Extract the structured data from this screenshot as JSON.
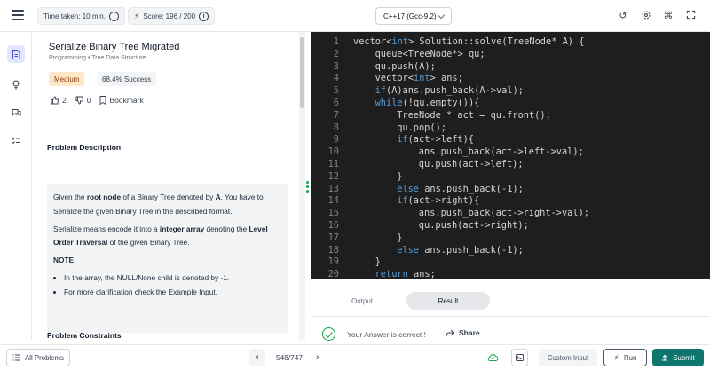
{
  "topbar": {
    "time_taken": "Time taken: 10 min.",
    "score": "Score:  196  /  200",
    "language": "C++17 (Gcc-9.2)"
  },
  "problem": {
    "title": "Serialize Binary Tree Migrated",
    "breadcrumb": "Programming • Tree Data Structure",
    "difficulty": "Medium",
    "success_rate": "68.4% Success",
    "likes": "2",
    "dislikes": "0",
    "bookmark_label": "Bookmark",
    "description_heading": "Problem Description",
    "desc": {
      "p1_a": "Given the ",
      "p1_b": "root node",
      "p1_c": "  of a Binary Tree denoted by ",
      "p1_d": "A",
      "p1_e": ". You have to Serialize the given Binary Tree in the described format.",
      "p2_a": "Serialize means encode it into a ",
      "p2_b": "integer array",
      "p2_c": " denoting the ",
      "p2_d": "Level Order Traversal",
      "p2_e": " of the given Binary Tree.",
      "note_label": "NOTE:",
      "bullets": [
        "In the array, the NULL/None child is denoted by -1.",
        "For more clarification check the Example Input."
      ]
    },
    "constraints_heading": "Problem Constraints"
  },
  "editor": {
    "lines": [
      {
        "n": "1",
        "indent": 0,
        "segs": [
          [
            "vector<",
            ""
          ],
          [
            "int",
            "kw"
          ],
          [
            "> Solution::solve(TreeNode* A) {",
            ""
          ]
        ]
      },
      {
        "n": "2",
        "indent": 1,
        "segs": [
          [
            "queue<TreeNode*> qu;",
            ""
          ]
        ]
      },
      {
        "n": "3",
        "indent": 1,
        "segs": [
          [
            "qu.push(A);",
            ""
          ]
        ]
      },
      {
        "n": "4",
        "indent": 1,
        "segs": [
          [
            "vector<",
            ""
          ],
          [
            "int",
            "kw"
          ],
          [
            "> ans;",
            ""
          ]
        ]
      },
      {
        "n": "5",
        "indent": 1,
        "segs": [
          [
            "if",
            "kw"
          ],
          [
            "(A)ans.push_back(A->val);",
            ""
          ]
        ]
      },
      {
        "n": "6",
        "indent": 1,
        "segs": [
          [
            "while",
            "kw"
          ],
          [
            "(!qu.empty()){",
            ""
          ]
        ]
      },
      {
        "n": "7",
        "indent": 2,
        "segs": [
          [
            "TreeNode * act = qu.front();",
            ""
          ]
        ]
      },
      {
        "n": "8",
        "indent": 2,
        "segs": [
          [
            "qu.pop();",
            ""
          ]
        ]
      },
      {
        "n": "9",
        "indent": 2,
        "segs": [
          [
            "if",
            "kw"
          ],
          [
            "(act->left){",
            ""
          ]
        ]
      },
      {
        "n": "10",
        "indent": 3,
        "segs": [
          [
            "ans.push_back(act->left->val);",
            ""
          ]
        ]
      },
      {
        "n": "11",
        "indent": 3,
        "segs": [
          [
            "qu.push(act->left);",
            ""
          ]
        ]
      },
      {
        "n": "12",
        "indent": 2,
        "segs": [
          [
            "}",
            ""
          ]
        ]
      },
      {
        "n": "13",
        "indent": 2,
        "segs": [
          [
            "else",
            "kw"
          ],
          [
            " ans.push_back(-1);",
            ""
          ]
        ]
      },
      {
        "n": "14",
        "indent": 2,
        "segs": [
          [
            "if",
            "kw"
          ],
          [
            "(act->right){",
            ""
          ]
        ]
      },
      {
        "n": "15",
        "indent": 3,
        "segs": [
          [
            "ans.push_back(act->right->val);",
            ""
          ]
        ]
      },
      {
        "n": "16",
        "indent": 3,
        "segs": [
          [
            "qu.push(act->right);",
            ""
          ]
        ]
      },
      {
        "n": "17",
        "indent": 2,
        "segs": [
          [
            "}",
            ""
          ]
        ]
      },
      {
        "n": "18",
        "indent": 2,
        "segs": [
          [
            "else",
            "kw"
          ],
          [
            " ans.push_back(-1);",
            ""
          ]
        ]
      },
      {
        "n": "19",
        "indent": 1,
        "segs": [
          [
            "}",
            ""
          ]
        ]
      },
      {
        "n": "20",
        "indent": 1,
        "segs": [
          [
            "return",
            "kw"
          ],
          [
            " ans;",
            ""
          ]
        ]
      }
    ]
  },
  "output": {
    "tab_output": "Output",
    "tab_result": "Result",
    "result_message": "Your Answer is correct !",
    "share_label": "Share"
  },
  "footer": {
    "all_problems": "All Problems",
    "pagination": "548/747",
    "custom_input": "Custom Input",
    "run": "Run",
    "submit": "Submit"
  },
  "colors": {
    "accent": "#0f766e",
    "success": "#16a34a",
    "editor_bg": "#1e1e1e",
    "keyword": "#569cd6"
  }
}
